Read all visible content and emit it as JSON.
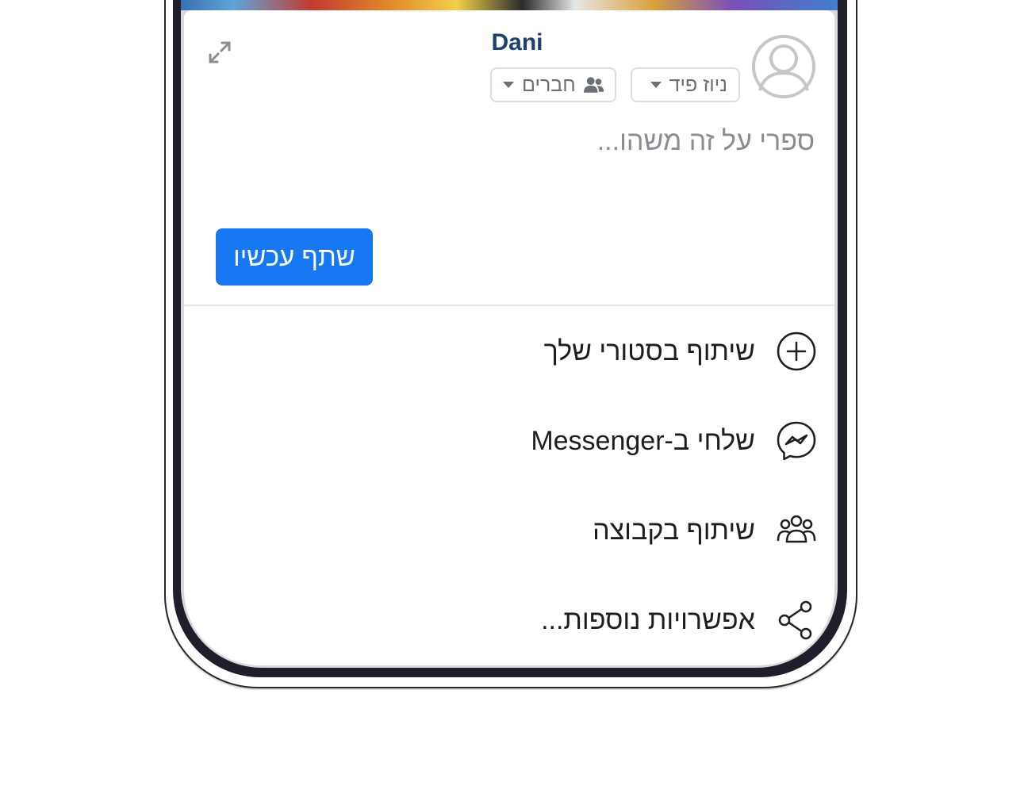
{
  "post_composer": {
    "user_name": "Dani",
    "audience": {
      "destination_label": "ניוז פיד",
      "privacy_label": "חברים"
    },
    "compose_placeholder": "ספרי על זה משהו...",
    "share_now_label": "שתף עכשיו"
  },
  "share_options": [
    {
      "label": "שיתוף בסטורי שלך",
      "icon": "plus-circle-icon"
    },
    {
      "label": "שלחי ב-Messenger",
      "icon": "messenger-icon"
    },
    {
      "label": "שיתוף בקבוצה",
      "icon": "group-icon"
    },
    {
      "label": "אפשרויות נוספות...",
      "icon": "share-icon"
    }
  ],
  "colors": {
    "accent": "#1877f2",
    "name": "#1f3f6e",
    "muted_text": "#8a8d91"
  }
}
